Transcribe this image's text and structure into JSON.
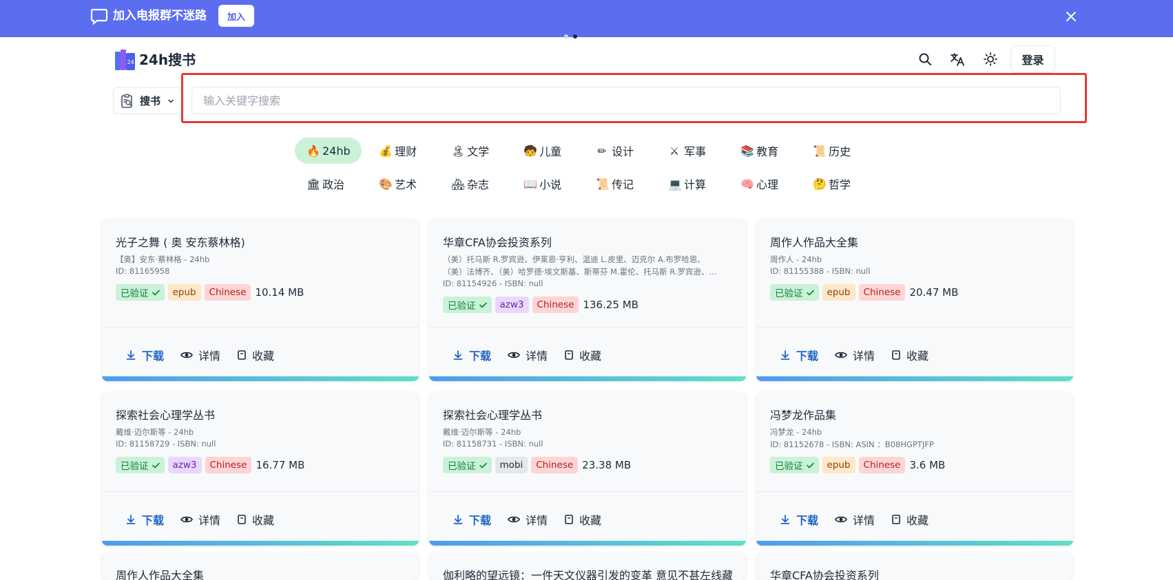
{
  "banner": {
    "text": "加入电报群不迷路",
    "join_label": "加入"
  },
  "header": {
    "logo_text": "24h搜书",
    "login_label": "登录",
    "icons": [
      "search-icon",
      "translate-icon",
      "theme-icon"
    ]
  },
  "search": {
    "type_label": "搜书",
    "placeholder": "输入关键字搜索",
    "value": ""
  },
  "categories": {
    "row1": [
      {
        "emoji": "🔥",
        "label": "24hb"
      },
      {
        "emoji": "💰",
        "label": "理财"
      },
      {
        "emoji": "🏝",
        "label": "文学"
      },
      {
        "emoji": "🧒",
        "label": "儿童"
      },
      {
        "emoji": "✏",
        "label": "设计"
      },
      {
        "emoji": "⚔",
        "label": "军事"
      },
      {
        "emoji": "📚",
        "label": "教育"
      },
      {
        "emoji": "📜",
        "label": "历史"
      }
    ],
    "row2": [
      {
        "emoji": "🏛",
        "label": "政治"
      },
      {
        "emoji": "🎨",
        "label": "艺术"
      },
      {
        "emoji": "🏘",
        "label": "杂志"
      },
      {
        "emoji": "📖",
        "label": "小说"
      },
      {
        "emoji": "📜",
        "label": "传记"
      },
      {
        "emoji": "💻",
        "label": "计算"
      },
      {
        "emoji": "🧠",
        "label": "心理"
      },
      {
        "emoji": "🤔",
        "label": "哲学"
      }
    ]
  },
  "actions": {
    "download": "下载",
    "details": "详情",
    "favorite": "收藏"
  },
  "verified_label": "已验证",
  "books": [
    {
      "title": "光子之舞 ( 奥 安东蔡林格)",
      "author": "【奥】安东·蔡林格 - 24hb",
      "author2": "",
      "id_line": "ID: 81165958",
      "format": "epub",
      "language": "Chinese",
      "size": "10.14 MB"
    },
    {
      "title": "华章CFA协会投资系列",
      "author": "（美）托马斯 R.罗宾逊、伊莱恩·亨利、温迪 L.皮里、迈克尔 A.布罗哈恩、",
      "author2": "（美）法博齐、（美）哈罗德·埃文斯基、斯蒂芬 M.霍伦、托马斯 R.罗宾逊、...",
      "id_line": "ID: 81154926 - ISBN: null",
      "format": "azw3",
      "language": "Chinese",
      "size": "136.25 MB"
    },
    {
      "title": "周作人作品大全集",
      "author": "周作人 - 24hb",
      "author2": "",
      "id_line": "ID: 81155388 - ISBN: null",
      "format": "epub",
      "language": "Chinese",
      "size": "20.47 MB"
    },
    {
      "title": "探索社会心理学丛书",
      "author": "戴维·迈尔斯等 - 24hb",
      "author2": "",
      "id_line": "ID: 81158729 - ISBN: null",
      "format": "azw3",
      "language": "Chinese",
      "size": "16.77 MB"
    },
    {
      "title": "探索社会心理学丛书",
      "author": "戴维·迈尔斯等 - 24hb",
      "author2": "",
      "id_line": "ID: 81158731 - ISBN: null",
      "format": "mobi",
      "language": "Chinese",
      "size": "23.38 MB"
    },
    {
      "title": "冯梦龙作品集",
      "author": "冯梦龙 - 24hb",
      "author2": "",
      "id_line": "ID: 81152678 - ISBN: ASIN ：B08HGPTJFP",
      "format": "epub",
      "language": "Chinese",
      "size": "3.6 MB"
    }
  ],
  "partial_titles": [
    "周作人作品大全集",
    "伽利略的望远镜：一件天文仪器引发的变革 意见不甚左线藏",
    "华章CFA协会投资系列"
  ],
  "colors": {
    "banner": "#5b6ef0",
    "accent_download": "#1d64c8",
    "highlight": "#e53935",
    "active_category": "#c9f2d7"
  }
}
